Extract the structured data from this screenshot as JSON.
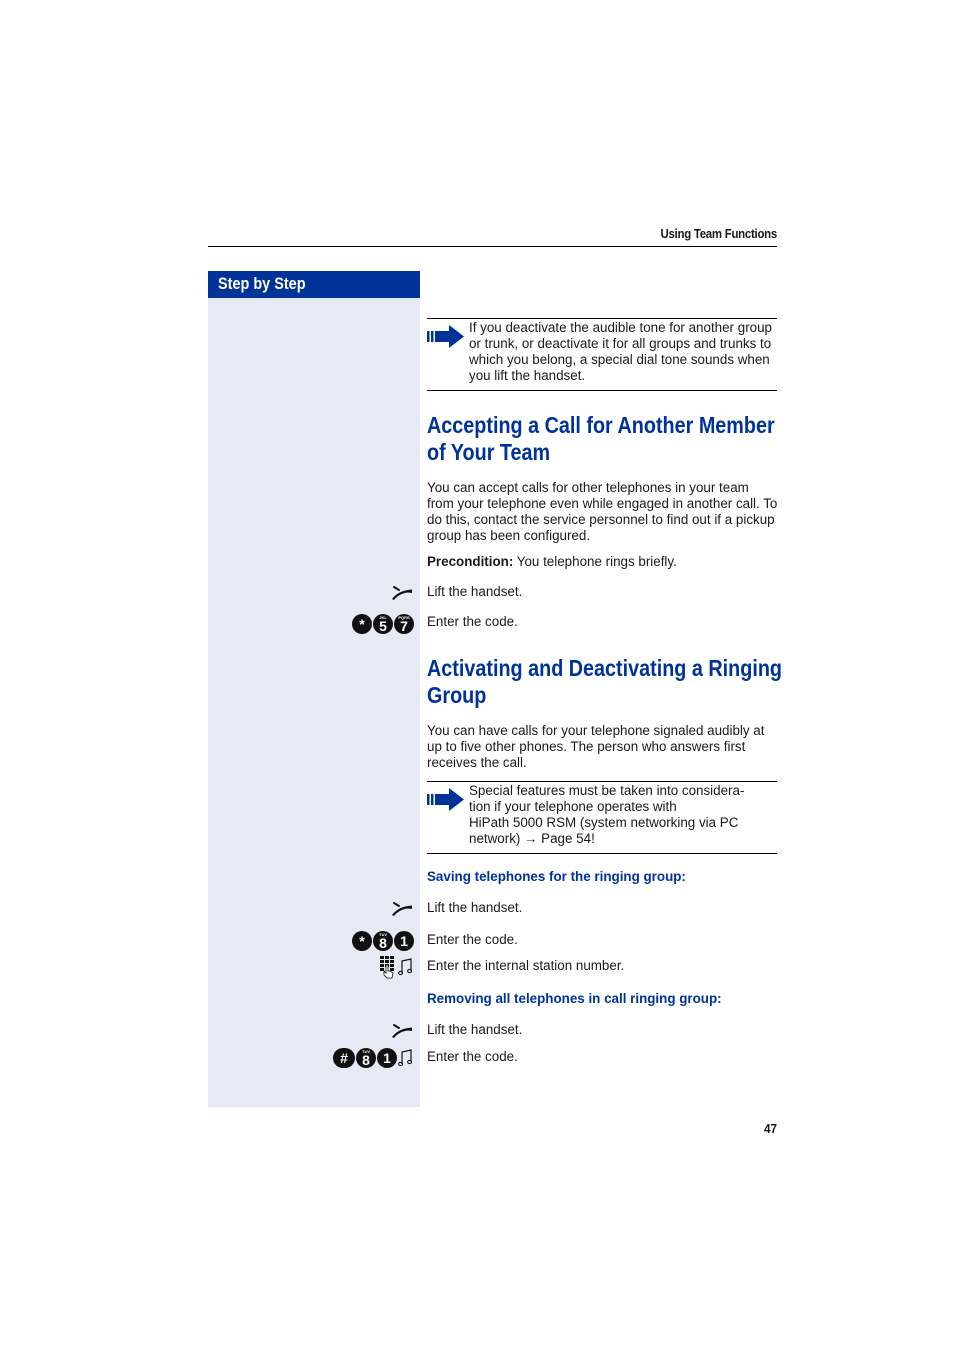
{
  "header": {
    "running_title": "Using Team Functions"
  },
  "sidebar": {
    "title": "Step by Step"
  },
  "note_top": {
    "icon": "note-arrow-icon",
    "text": "If you deactivate the audible tone for another group or trunk, or deactivate it for all groups and trunks to which you belong, a special dial tone sounds when you lift the handset."
  },
  "section1": {
    "title_line1": "Accepting a Call for Another Member",
    "title_line2": "of Your Team",
    "intro": "You can accept calls for other telephones in your team from your telephone even while engaged in another call. To do this, contact the service personnel to find out if a pickup group has been configured.",
    "precondition_label": "Precondition:",
    "precondition_text": " You telephone rings briefly.",
    "steps": [
      {
        "icons": [
          "handset-lift-icon"
        ],
        "text": "Lift the handset."
      },
      {
        "icons": [
          "key-star",
          "key-5",
          "key-7"
        ],
        "keys": [
          "*",
          "5",
          "7"
        ],
        "text": "Enter the code."
      }
    ]
  },
  "section2": {
    "title_line1": "Activating and Deactivating a Ringing",
    "title_line2": "Group",
    "intro": "You can have calls for your telephone signaled audibly at up to five other phones. The person who answers first receives the call.",
    "note": {
      "icon": "note-arrow-icon",
      "text_line1": "Special features must be taken into considera-",
      "text_line2": "tion if your telephone operates with",
      "text_line3": "HiPath 5000 RSM (system networking via PC",
      "text_line4": "network) → Page 54!"
    },
    "subsection_save": {
      "title": "Saving telephones for the ringing group:",
      "steps": [
        {
          "icons": [
            "handset-lift-icon"
          ],
          "text": "Lift the handset."
        },
        {
          "keys": [
            "*",
            "8",
            "1"
          ],
          "text": "Enter the code."
        },
        {
          "icons": [
            "keypad-icon",
            "tone-icon"
          ],
          "text": "Enter the internal station number."
        }
      ]
    },
    "subsection_remove": {
      "title": "Removing all telephones in call ringing group:",
      "steps": [
        {
          "icons": [
            "handset-lift-icon"
          ],
          "text": "Lift the handset."
        },
        {
          "keys": [
            "#",
            "8",
            "1"
          ],
          "icons": [
            "tone-icon"
          ],
          "text": "Enter the code."
        }
      ]
    }
  },
  "key_sublabels": {
    "5": "JKL",
    "7": "PQRS",
    "8": "TUV"
  },
  "footer": {
    "page_number": "47"
  },
  "colors": {
    "brand_blue": "#003399",
    "sidebar_bg": "#e6eaf4"
  }
}
